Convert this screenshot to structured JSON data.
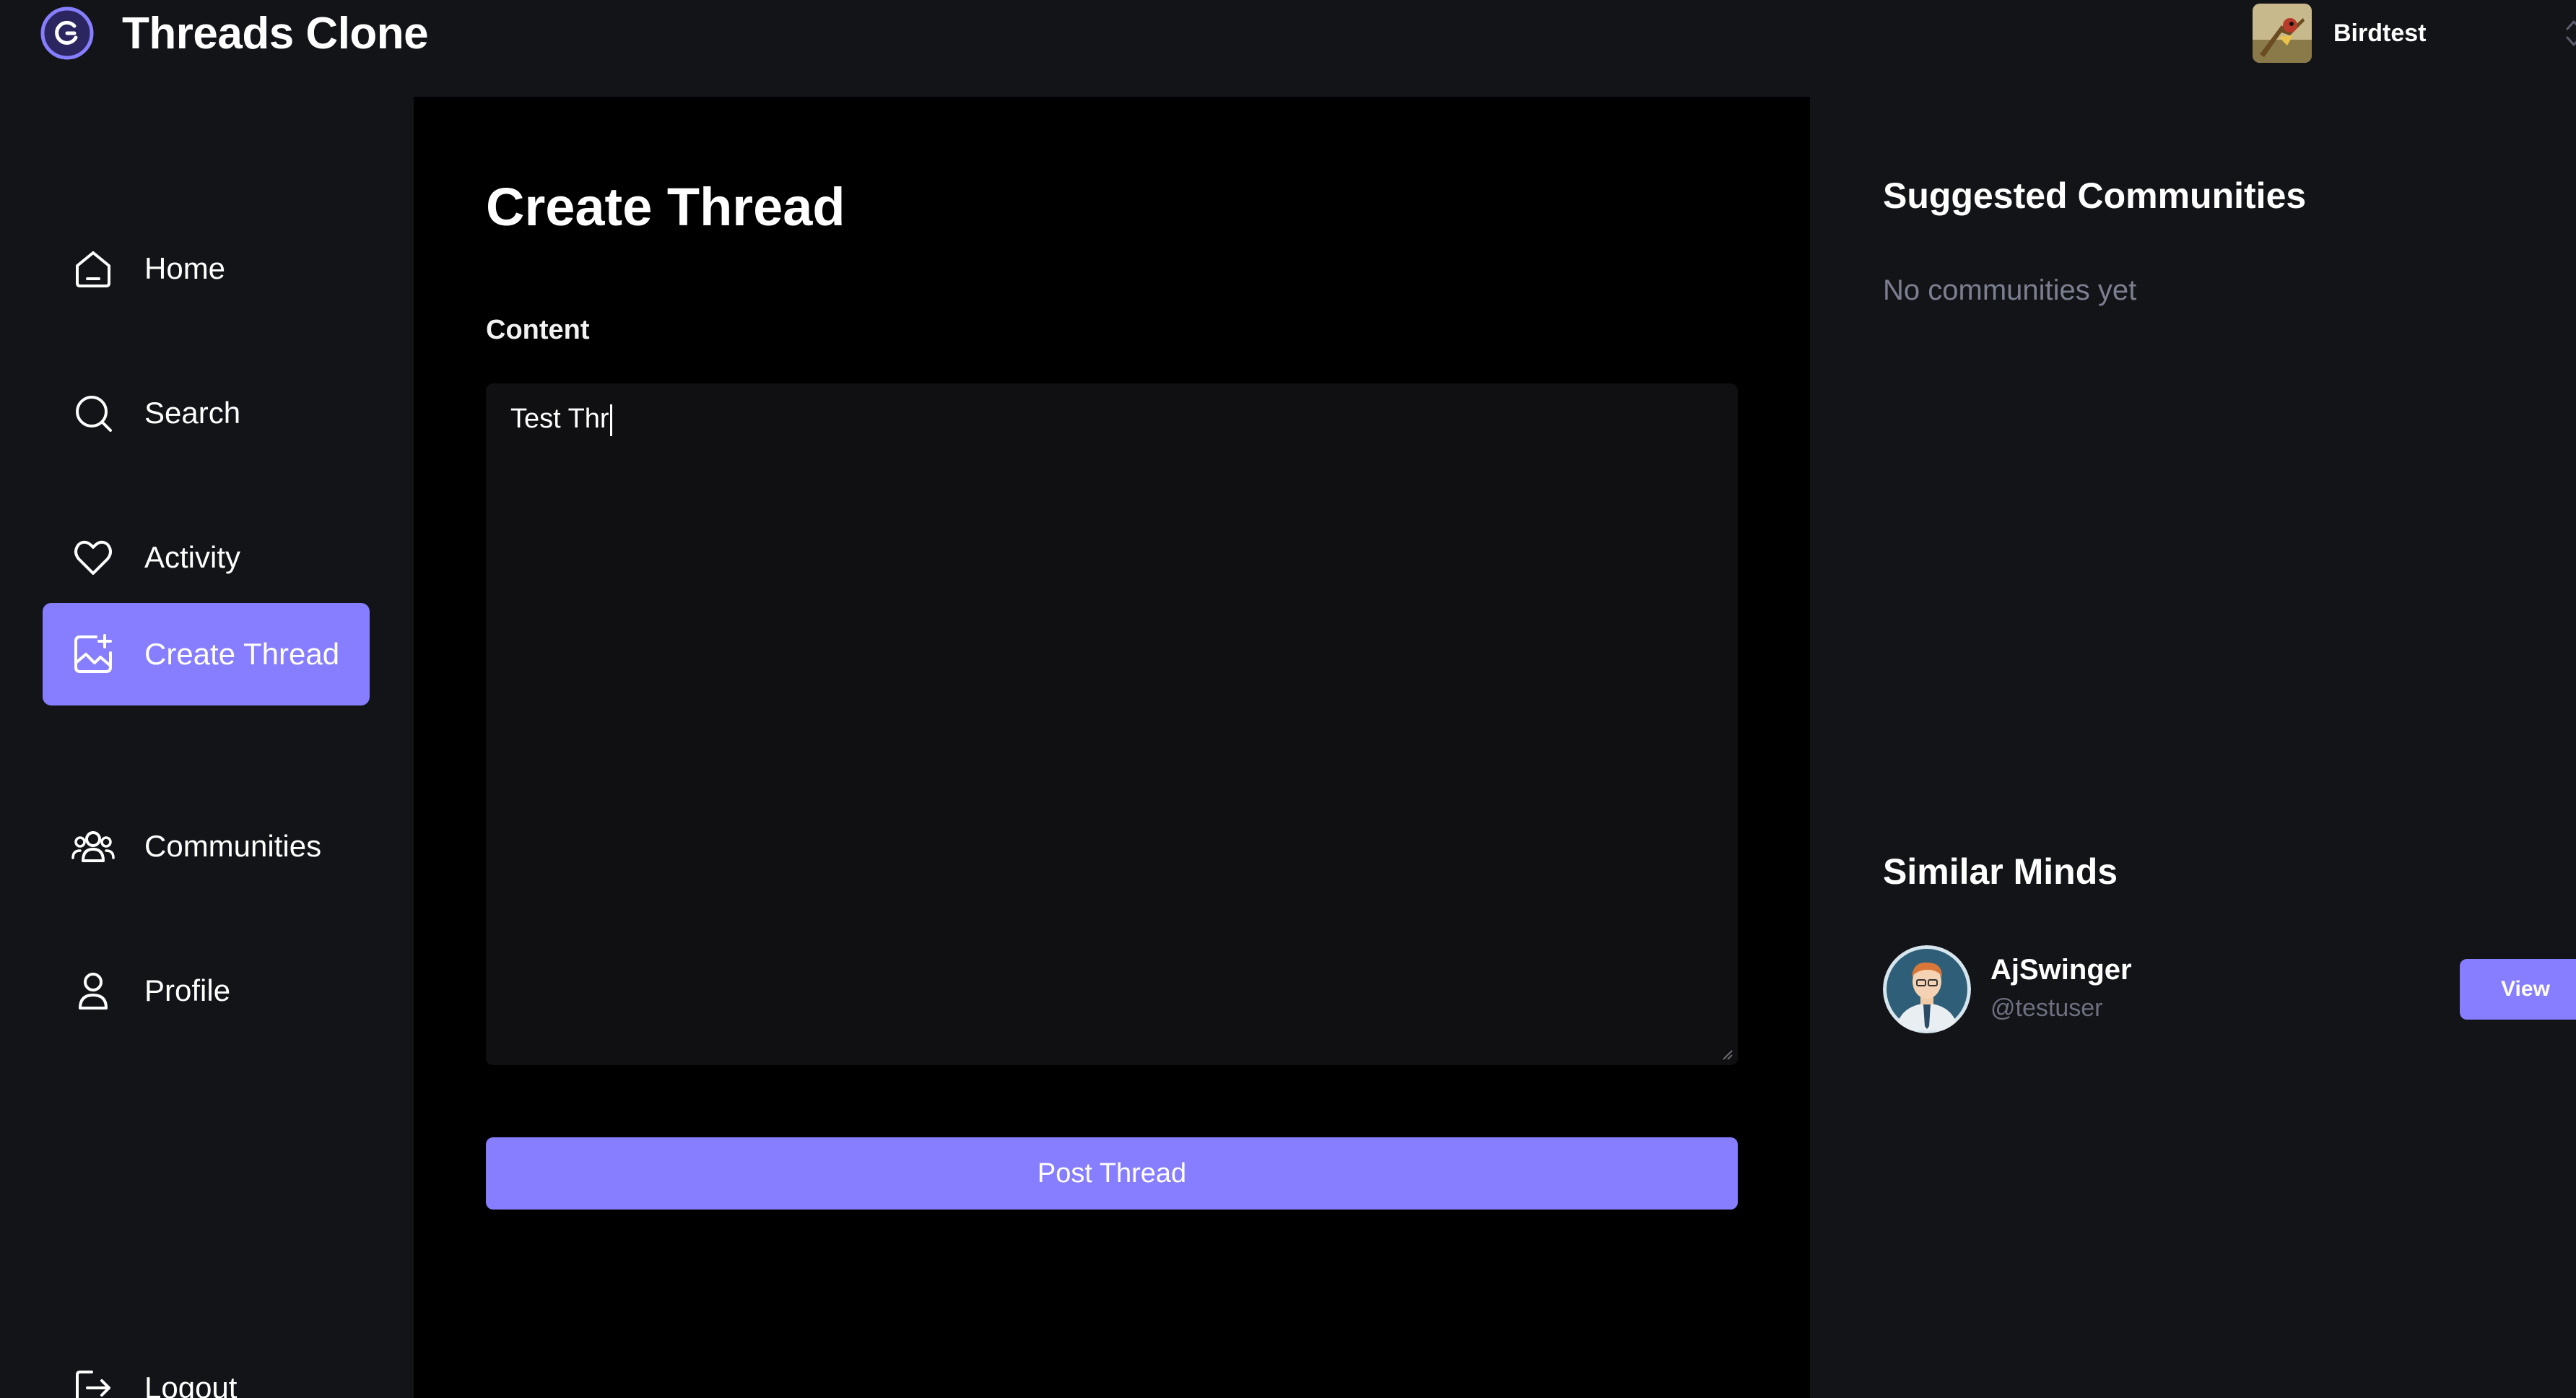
{
  "app": {
    "title": "Threads Clone",
    "logo_icon": "threads-logo-icon",
    "accent_color": "#877eff"
  },
  "account": {
    "name": "Birdtest",
    "switch_icon": "chevron-up-down-icon"
  },
  "sidebar": {
    "items": [
      {
        "label": "Home",
        "icon": "home-icon",
        "active": false
      },
      {
        "label": "Search",
        "icon": "search-icon",
        "active": false
      },
      {
        "label": "Activity",
        "icon": "heart-icon",
        "active": false
      },
      {
        "label": "Create Thread",
        "icon": "image-plus-icon",
        "active": true
      },
      {
        "label": "Communities",
        "icon": "users-icon",
        "active": false
      },
      {
        "label": "Profile",
        "icon": "user-icon",
        "active": false
      }
    ],
    "logout_label": "Logout"
  },
  "main": {
    "title": "Create Thread",
    "content_label": "Content",
    "content_value": "Test Thr",
    "post_button_label": "Post Thread"
  },
  "right_sidebar": {
    "suggested_title": "Suggested Communities",
    "suggested_empty": "No communities yet",
    "similar_title": "Similar Minds",
    "users": [
      {
        "name": "AjSwinger",
        "handle": "@testuser",
        "button_label": "View"
      }
    ]
  }
}
